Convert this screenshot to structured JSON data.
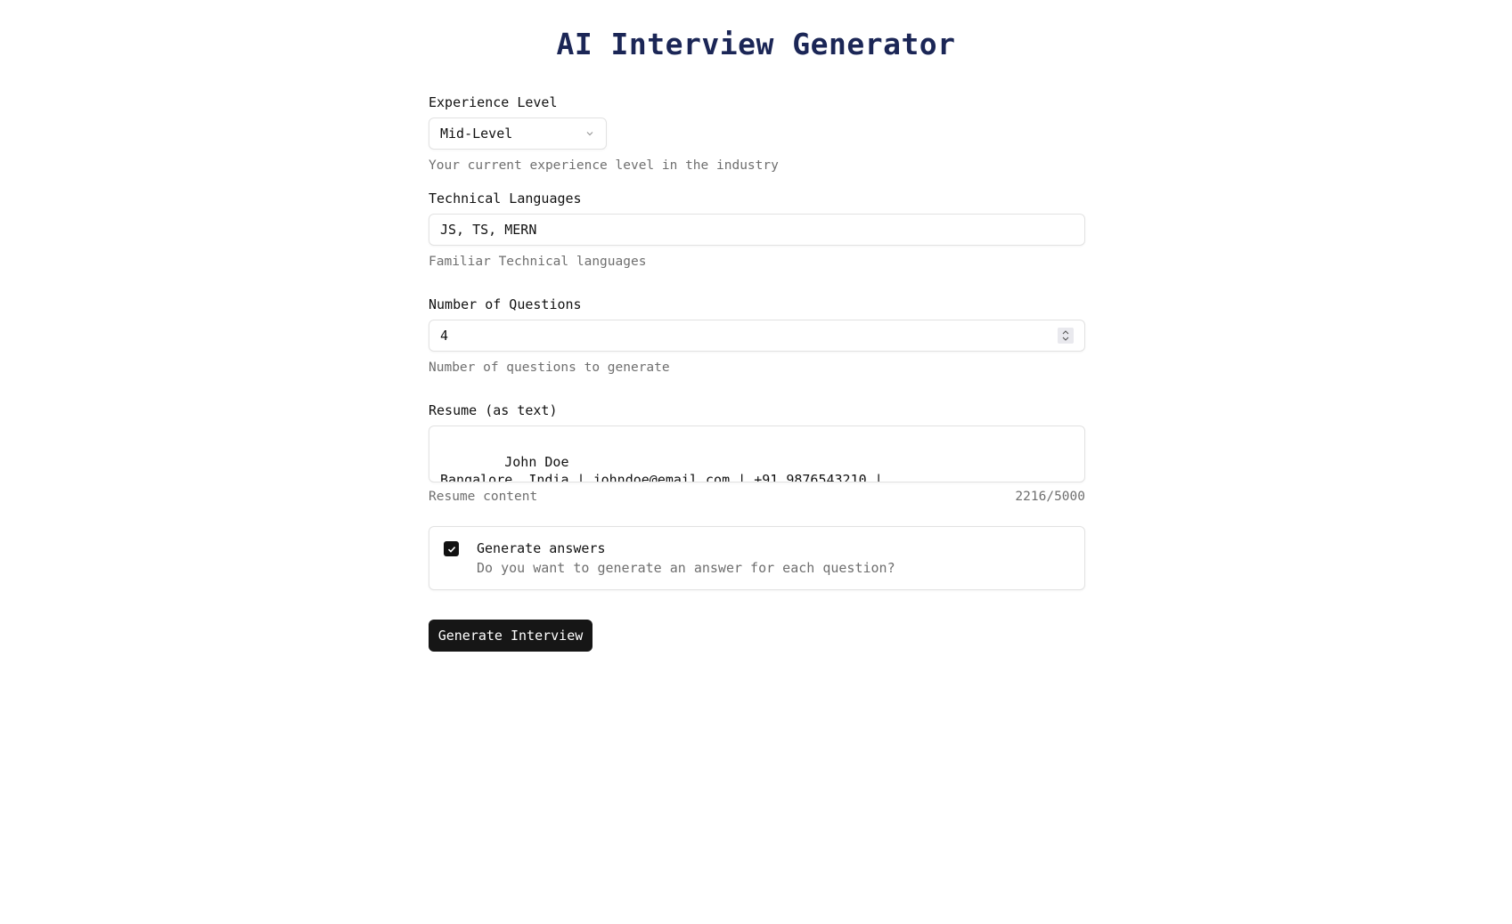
{
  "page": {
    "title": "AI Interview Generator"
  },
  "experience": {
    "label": "Experience Level",
    "selected": "Mid-Level",
    "help": "Your current experience level in the industry"
  },
  "languages": {
    "label": "Technical Languages",
    "value": "JS, TS, MERN",
    "help": "Familiar Technical languages"
  },
  "questions": {
    "label": "Number of Questions",
    "value": "4",
    "help": "Number of questions to generate"
  },
  "resume": {
    "label": "Resume (as text)",
    "value": "John Doe\nBangalore, India | johndoe@email.com | +91 9876543210 | linkedin.com/in/johndoe |\ngithub.com/johndoe",
    "help": "Resume content",
    "counter": "2216/5000"
  },
  "answers": {
    "checked": true,
    "title": "Generate answers",
    "description": "Do you want to generate an answer for each question?"
  },
  "submit": {
    "label": "Generate Interview"
  }
}
